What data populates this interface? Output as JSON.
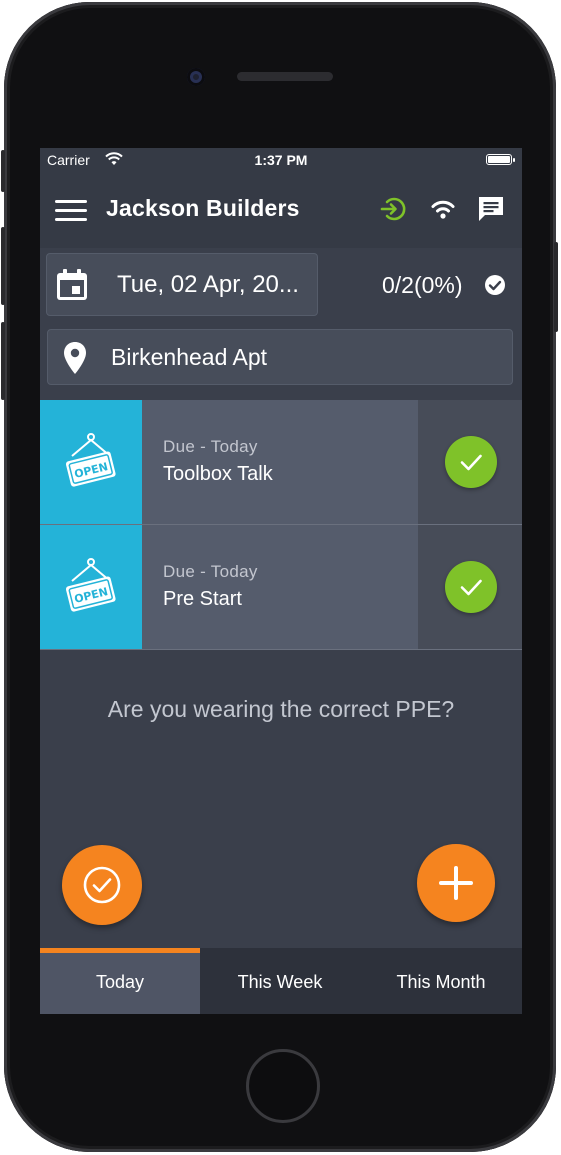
{
  "status_bar": {
    "carrier": "Carrier",
    "time": "1:37 PM",
    "wifi_icon": "wifi-icon",
    "battery_icon": "battery-icon"
  },
  "app_bar": {
    "menu_icon": "hamburger-menu-icon",
    "title": "Jackson Builders",
    "icons": [
      "sync-in-icon",
      "wifi-icon",
      "chat-icon"
    ],
    "sync_color": "#7fc229"
  },
  "date_selector": {
    "icon": "calendar-icon",
    "value": "Tue, 02 Apr, 20..."
  },
  "progress": {
    "text": "0/2(0%)",
    "icon": "check-circle-icon"
  },
  "site_selector": {
    "icon": "location-pin-icon",
    "value": "Birkenhead Apt"
  },
  "tasks": [
    {
      "badge_icon": "open-sign-icon",
      "due": "Due - Today",
      "name": "Toolbox Talk",
      "action_icon": "check-icon"
    },
    {
      "badge_icon": "open-sign-icon",
      "due": "Due - Today",
      "name": "Pre Start",
      "action_icon": "check-icon"
    }
  ],
  "prompt": "Are you wearing the correct PPE?",
  "fabs": {
    "left_icon": "check-circle-outline-icon",
    "right_icon": "plus-icon",
    "color": "#f5841f"
  },
  "tabs": [
    {
      "label": "Today",
      "active": true
    },
    {
      "label": "This Week",
      "active": false
    },
    {
      "label": "This Month",
      "active": false
    }
  ],
  "colors": {
    "accent": "#f5841f",
    "task_badge": "#24b3d8",
    "done_green": "#7fc229",
    "background": "#3a3f4b"
  }
}
